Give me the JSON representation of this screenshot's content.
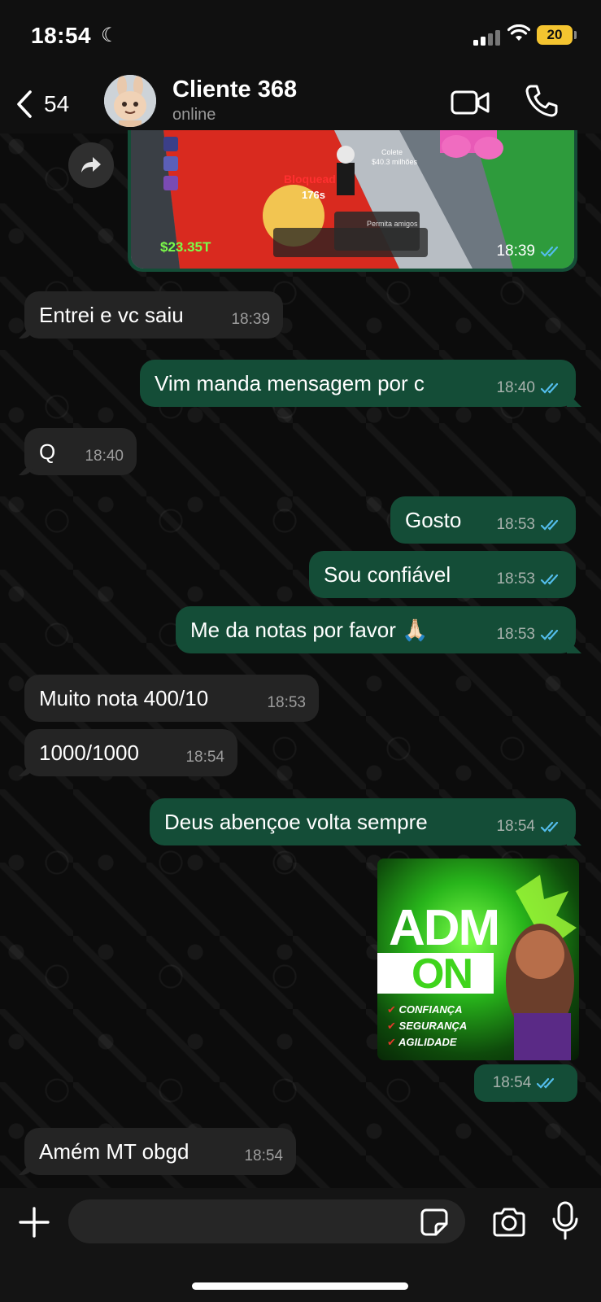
{
  "status_bar": {
    "time": "18:54",
    "battery": "20"
  },
  "header": {
    "back_count": "54",
    "contact_name": "Cliente 368",
    "contact_status": "online"
  },
  "game_image": {
    "time": "18:39",
    "money": "$23.35T",
    "timer": "176s",
    "blocked_label": "Bloquead",
    "collect_label": "Colete",
    "collect_value": "$40.3 milhões",
    "friends_label": "Permita amigos"
  },
  "messages": [
    {
      "text": "Entrei e vc saiu",
      "time": "18:39"
    },
    {
      "text": "Vim manda mensagem por c",
      "time": "18:40"
    },
    {
      "text": "Q",
      "time": "18:40"
    },
    {
      "text": "Gosto",
      "time": "18:53"
    },
    {
      "text": "Sou confiável",
      "time": "18:53"
    },
    {
      "text": "Me da notas por favor 🙏🏻",
      "time": "18:53"
    },
    {
      "text": "Muito nota 400/10",
      "time": "18:53"
    },
    {
      "text": "1000/1000",
      "time": "18:54"
    },
    {
      "text": "Deus abençoe volta sempre",
      "time": "18:54"
    },
    {
      "text": "Amém MT obgd",
      "time": "18:54"
    }
  ],
  "adm_image": {
    "time": "18:54",
    "headline": "ADM",
    "subheadline": "ON",
    "features": [
      "CONFIANÇA",
      "SEGURANÇA",
      "AGILIDADE"
    ]
  },
  "colors": {
    "incoming_bubble": "#242424",
    "outgoing_bubble": "#144d37",
    "read_ticks": "#53bdeb"
  },
  "icons": [
    "back-chevron-icon",
    "video-call-icon",
    "phone-icon",
    "forward-icon",
    "plus-icon",
    "sticker-icon",
    "camera-icon",
    "microphone-icon",
    "read-ticks-icon"
  ]
}
